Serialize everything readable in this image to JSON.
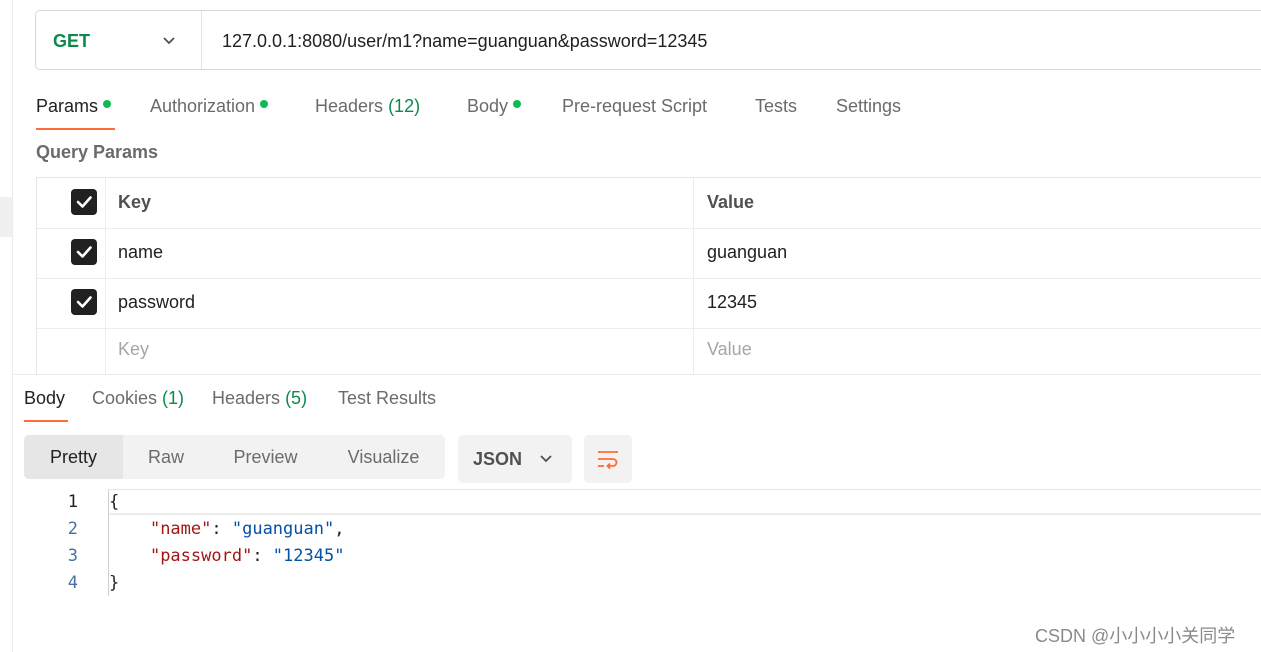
{
  "request": {
    "method": "GET",
    "url": "127.0.0.1:8080/user/m1?name=guanguan&password=12345"
  },
  "request_tabs": [
    {
      "label": "Params",
      "dot": true,
      "active": true
    },
    {
      "label": "Authorization",
      "dot": true
    },
    {
      "label": "Headers",
      "count": "(12)"
    },
    {
      "label": "Body",
      "dot": true
    },
    {
      "label": "Pre-request Script"
    },
    {
      "label": "Tests"
    },
    {
      "label": "Settings"
    }
  ],
  "query_params": {
    "title": "Query Params",
    "headers": {
      "key": "Key",
      "value": "Value"
    },
    "rows": [
      {
        "key": "name",
        "value": "guanguan",
        "checked": true
      },
      {
        "key": "password",
        "value": "12345",
        "checked": true
      }
    ],
    "placeholder": {
      "key": "Key",
      "value": "Value"
    }
  },
  "response_tabs": [
    {
      "label": "Body",
      "active": true
    },
    {
      "label": "Cookies",
      "count": "(1)"
    },
    {
      "label": "Headers",
      "count": "(5)"
    },
    {
      "label": "Test Results"
    }
  ],
  "view_modes": [
    "Pretty",
    "Raw",
    "Preview",
    "Visualize"
  ],
  "format": "JSON",
  "code": {
    "line_numbers": [
      "1",
      "2",
      "3",
      "4"
    ],
    "open_brace": "{",
    "close_brace": "}",
    "name_key": "\"name\"",
    "name_value": "\"guanguan\"",
    "password_key": "\"password\"",
    "password_value": "\"12345\"",
    "colon": ": ",
    "comma": ","
  },
  "watermark": "CSDN @小小小小关同学",
  "colors": {
    "accent": "#ff6c37",
    "method_get": "#0b8a4a",
    "dot": "#0cbb52"
  }
}
